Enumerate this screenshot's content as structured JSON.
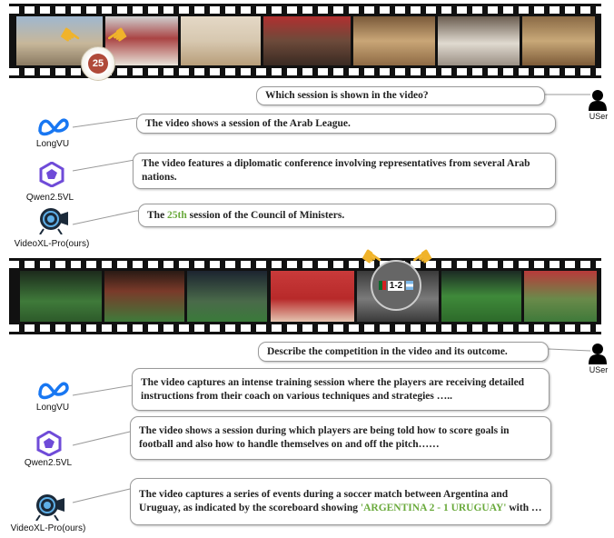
{
  "example1": {
    "user_label": "USer",
    "question": "Which session is shown in the video?",
    "badge_number": "25",
    "answers": {
      "longvu": {
        "model": "LongVU",
        "text": "The video shows a session of the Arab League."
      },
      "qwen": {
        "model": "Qwen2.5VL",
        "text": "The video features a diplomatic conference involving representatives from several Arab nations."
      },
      "videoxl": {
        "model": "VideoXL-Pro(ours)",
        "before": "The ",
        "highlight": "25th",
        "after": " session of the Council of Ministers."
      }
    }
  },
  "example2": {
    "user_label": "USer",
    "question": "Describe the competition in the video and its outcome.",
    "scoreboard": "1-2",
    "answers": {
      "longvu": {
        "model": "LongVU",
        "text": "The video captures an intense training session where the players are receiving detailed instructions from their coach on various techniques and strategies ….."
      },
      "qwen": {
        "model": "Qwen2.5VL",
        "text": "The video shows a session during which players are being told how to score goals in football and also how to handle themselves on and off the pitch……"
      },
      "videoxl": {
        "model": "VideoXL-Pro(ours)",
        "before": "The video captures a series of events during a soccer match between Argentina and Uruguay, as indicated by the scoreboard showing ",
        "highlight": "'ARGENTINA 2 - 1 URUGUAY'",
        "after": " with …"
      }
    }
  },
  "colors": {
    "highlight": "#6aaa3c",
    "meta_blue": "#1877f2",
    "qwen_purple": "#6f4bd8",
    "film": "#111111"
  }
}
